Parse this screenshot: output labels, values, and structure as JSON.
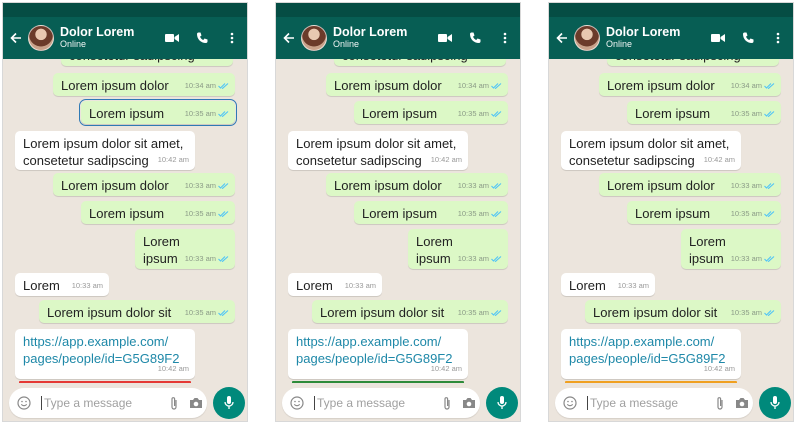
{
  "contact": {
    "name": "Dolor Lorem",
    "status": "Online"
  },
  "composer": {
    "placeholder": "Type a message"
  },
  "messages": [
    {
      "text1": "consetetur sadipscing",
      "time": "10:33 am"
    },
    {
      "text1": "Lorem ipsum dolor",
      "time": "10:34 am"
    },
    {
      "text1": "Lorem ipsum",
      "time": "10:35 am"
    },
    {
      "text1": "Lorem ipsum dolor sit amet,",
      "text2": "consetetur sadipscing",
      "time": "10:42 am"
    },
    {
      "text1": "Lorem ipsum dolor",
      "time": "10:33 am"
    },
    {
      "text1": "Lorem ipsum",
      "time": "10:35 am"
    },
    {
      "text1": "Lorem",
      "text2": "ipsum",
      "time": "10:33 am"
    },
    {
      "text1": "Lorem",
      "time": "10:33 am"
    },
    {
      "text1": "Lorem ipsum dolor sit",
      "time": "10:35 am"
    },
    {
      "text1": "https://app.example.com/",
      "text2": "pages/people/id=G5G89F2",
      "time": "10:42 am"
    }
  ],
  "link_underline_colors": [
    "#e53935",
    "#2e8b3a",
    "#f0a020"
  ],
  "colors": {
    "header": "#075e54",
    "outgoing": "#dcf8c6",
    "incoming": "#ffffff",
    "background": "#ece5dd",
    "tick": "#4fc3f7",
    "mic": "#00897b"
  }
}
